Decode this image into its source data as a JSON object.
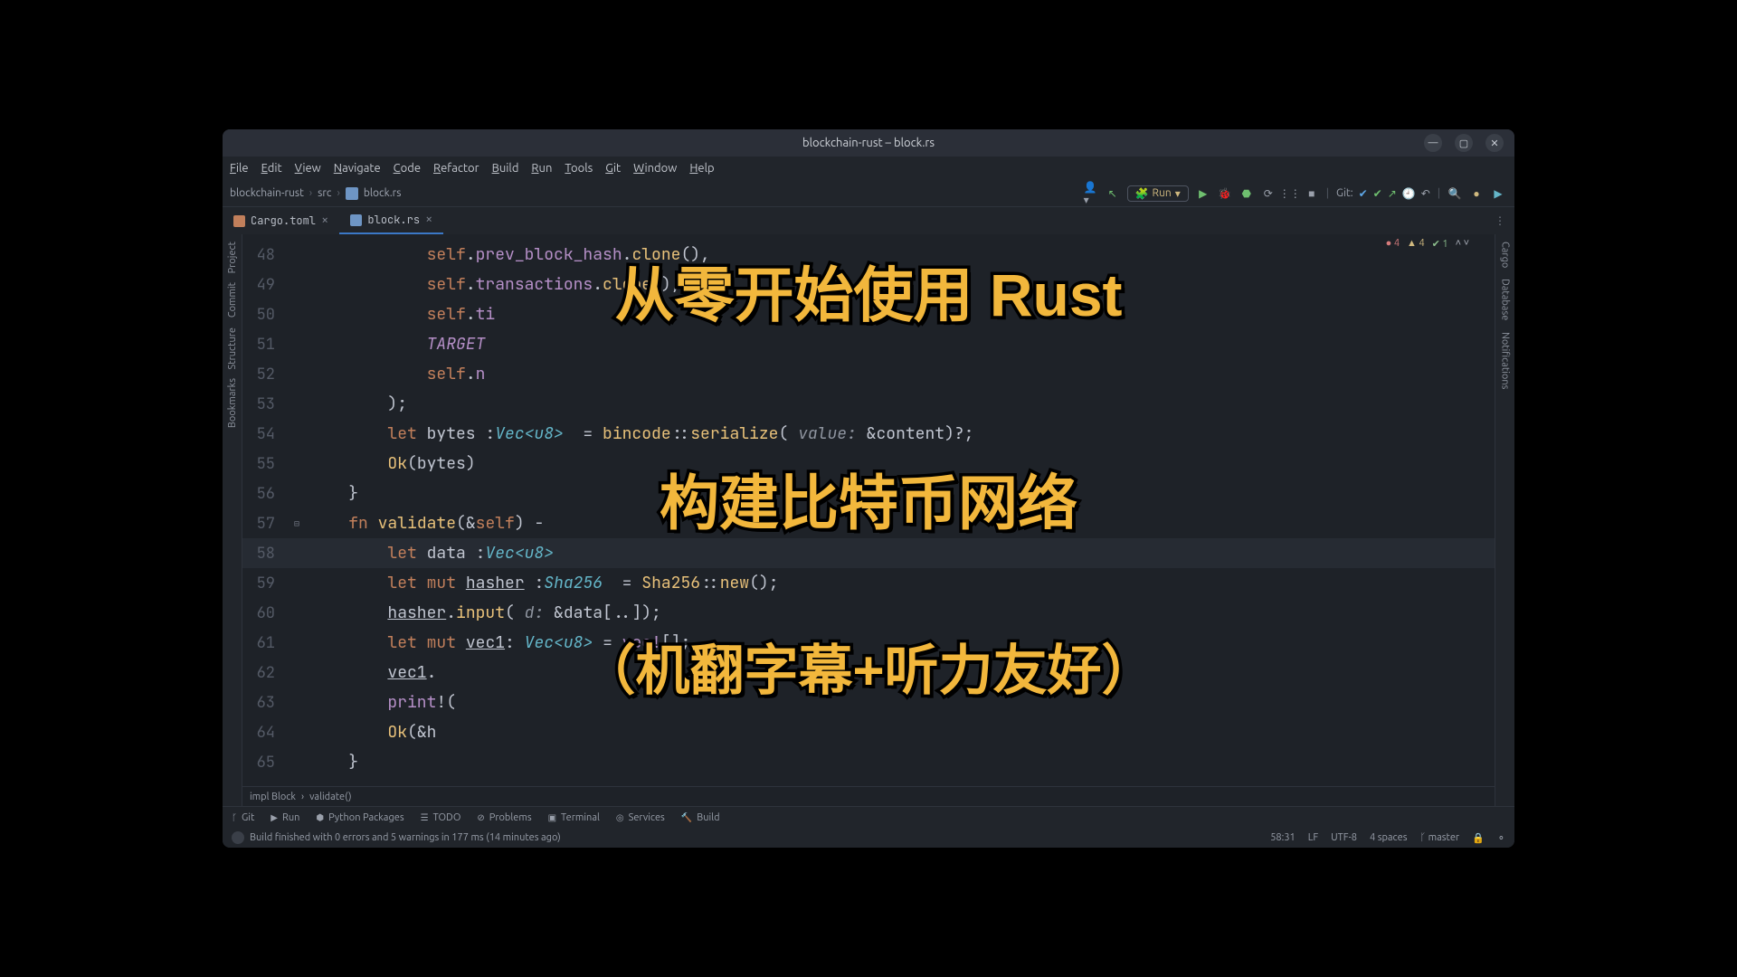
{
  "window": {
    "title": "blockchain-rust – block.rs"
  },
  "menu": [
    "File",
    "Edit",
    "View",
    "Navigate",
    "Code",
    "Refactor",
    "Build",
    "Run",
    "Tools",
    "Git",
    "Window",
    "Help"
  ],
  "breadcrumb": {
    "project": "blockchain-rust",
    "folder": "src",
    "file": "block.rs"
  },
  "toolbar": {
    "run_label": "Run",
    "git_label": "Git:"
  },
  "tabs": [
    {
      "label": "Cargo.toml",
      "active": false
    },
    {
      "label": "block.rs",
      "active": true
    }
  ],
  "inspections": {
    "errors": "4",
    "warnings": "4",
    "weak": "1"
  },
  "code_lines": [
    {
      "n": "48",
      "html": "            <span class='self'>self</span>.<span class='prop'>prev_block_hash</span>.<span class='fnname'>clone</span>(),"
    },
    {
      "n": "49",
      "html": "            <span class='self'>self</span>.<span class='prop'>transactions</span>.<span class='fnname'>clone</span>(),"
    },
    {
      "n": "50",
      "html": "            <span class='self'>self</span>.<span class='prop'>ti</span>"
    },
    {
      "n": "51",
      "html": "            <span class='const'>TARGET</span>"
    },
    {
      "n": "52",
      "html": "            <span class='self'>self</span>.<span class='prop'>n</span>"
    },
    {
      "n": "53",
      "html": "        );"
    },
    {
      "n": "54",
      "html": "        <span class='kw'>let</span> bytes :<span class='ty'>Vec&lt;u8&gt;</span>  = <span class='fnname'>bincode</span>::<span class='fnname'>serialize</span>( <span class='param'>value:</span> &amp;content)?;"
    },
    {
      "n": "55",
      "html": "        <span class='fnname'>Ok</span>(bytes)"
    },
    {
      "n": "56",
      "html": "    }"
    },
    {
      "n": "57",
      "html": "    <span class='kw'>fn</span> <span class='fnname'>validate</span>(&amp;<span class='self'>self</span>) -",
      "fold": true
    },
    {
      "n": "58",
      "html": "        <span class='kw'>let</span> data :<span class='ty'>Vec&lt;u8&gt;</span>",
      "current": true
    },
    {
      "n": "59",
      "html": "        <span class='kw'>let</span> <span class='kw'>mut</span> <span class='und'>hasher</span> :<span class='ty'>Sha256</span>  = <span class='fnname'>Sha256</span>::<span class='fnname'>new</span>();"
    },
    {
      "n": "60",
      "html": "        <span class='und'>hasher</span>.<span class='fnname'>input</span>( <span class='param'>d:</span> &amp;data[..]);"
    },
    {
      "n": "61",
      "html": "        <span class='kw'>let</span> <span class='kw'>mut</span> <span class='und'>vec1</span>: <span class='ty'>Vec&lt;u8&gt;</span> = <span class='macro'>vec!</span>[];"
    },
    {
      "n": "62",
      "html": "        <span class='und'>vec1</span>."
    },
    {
      "n": "63",
      "html": "        <span class='macro'>print</span>!("
    },
    {
      "n": "64",
      "html": "        <span class='fnname'>Ok</span>(&amp;h"
    },
    {
      "n": "65",
      "html": "    }"
    }
  ],
  "crumb2": {
    "a": "impl Block",
    "b": "validate()"
  },
  "bottom_tools": [
    "Git",
    "Run",
    "Python Packages",
    "TODO",
    "Problems",
    "Terminal",
    "Services",
    "Build"
  ],
  "status": {
    "left": "Build finished with 0 errors and 5 warnings in 177 ms (14 minutes ago)",
    "pos": "58:31",
    "sep": "LF",
    "enc": "UTF-8",
    "indent": "4 spaces",
    "branch": "master"
  },
  "side_left": [
    "Project",
    "Commit",
    "Structure",
    "Bookmarks"
  ],
  "side_right": [
    "Cargo",
    "Database",
    "Notifications"
  ],
  "overlay": {
    "l1": "从零开始使用 Rust",
    "l2": "构建比特币网络",
    "l3": "（机翻字幕+听力友好）"
  }
}
